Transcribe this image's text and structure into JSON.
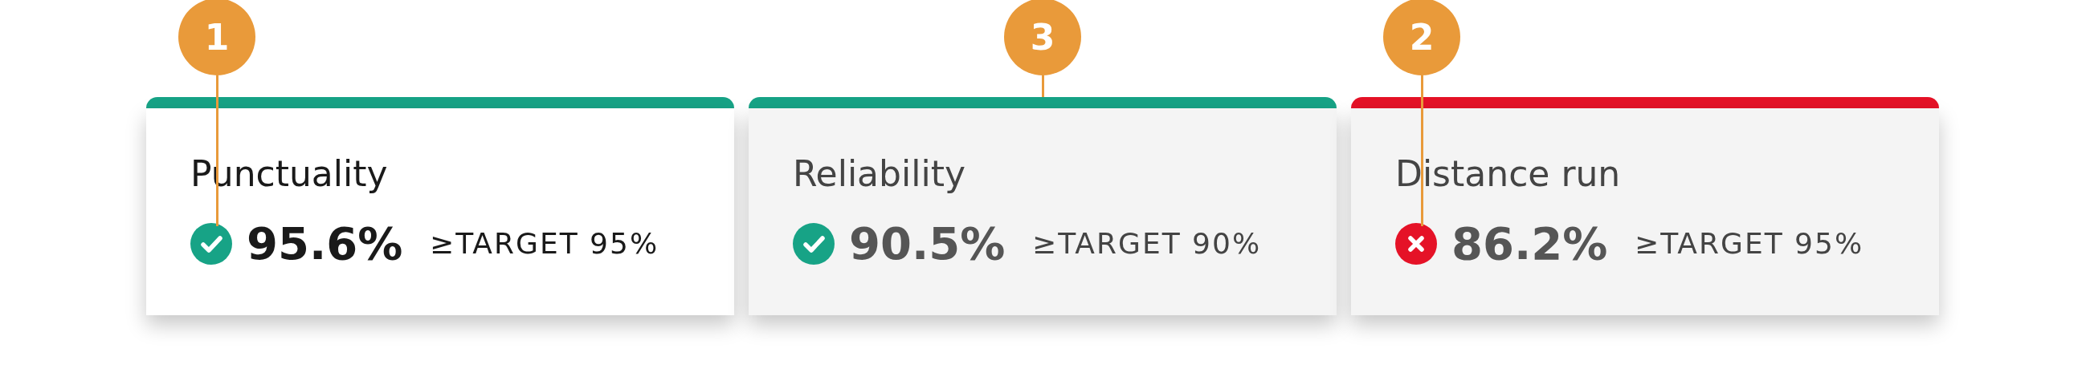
{
  "cards": [
    {
      "title": "Punctuality",
      "selected": true,
      "met": true,
      "color": "#17a386",
      "value": "95.6%",
      "target": "≥TARGET 95%",
      "callout": {
        "number": "1",
        "kind": "icon"
      }
    },
    {
      "title": "Reliability",
      "selected": false,
      "met": true,
      "color": "#17a386",
      "value": "90.5%",
      "target": "≥TARGET 90%",
      "callout": {
        "number": "3",
        "kind": "bar"
      }
    },
    {
      "title": "Distance run",
      "selected": false,
      "met": false,
      "color": "#e51227",
      "value": "86.2%",
      "target": "≥TARGET 95%",
      "callout": {
        "number": "2",
        "kind": "icon"
      }
    }
  ]
}
